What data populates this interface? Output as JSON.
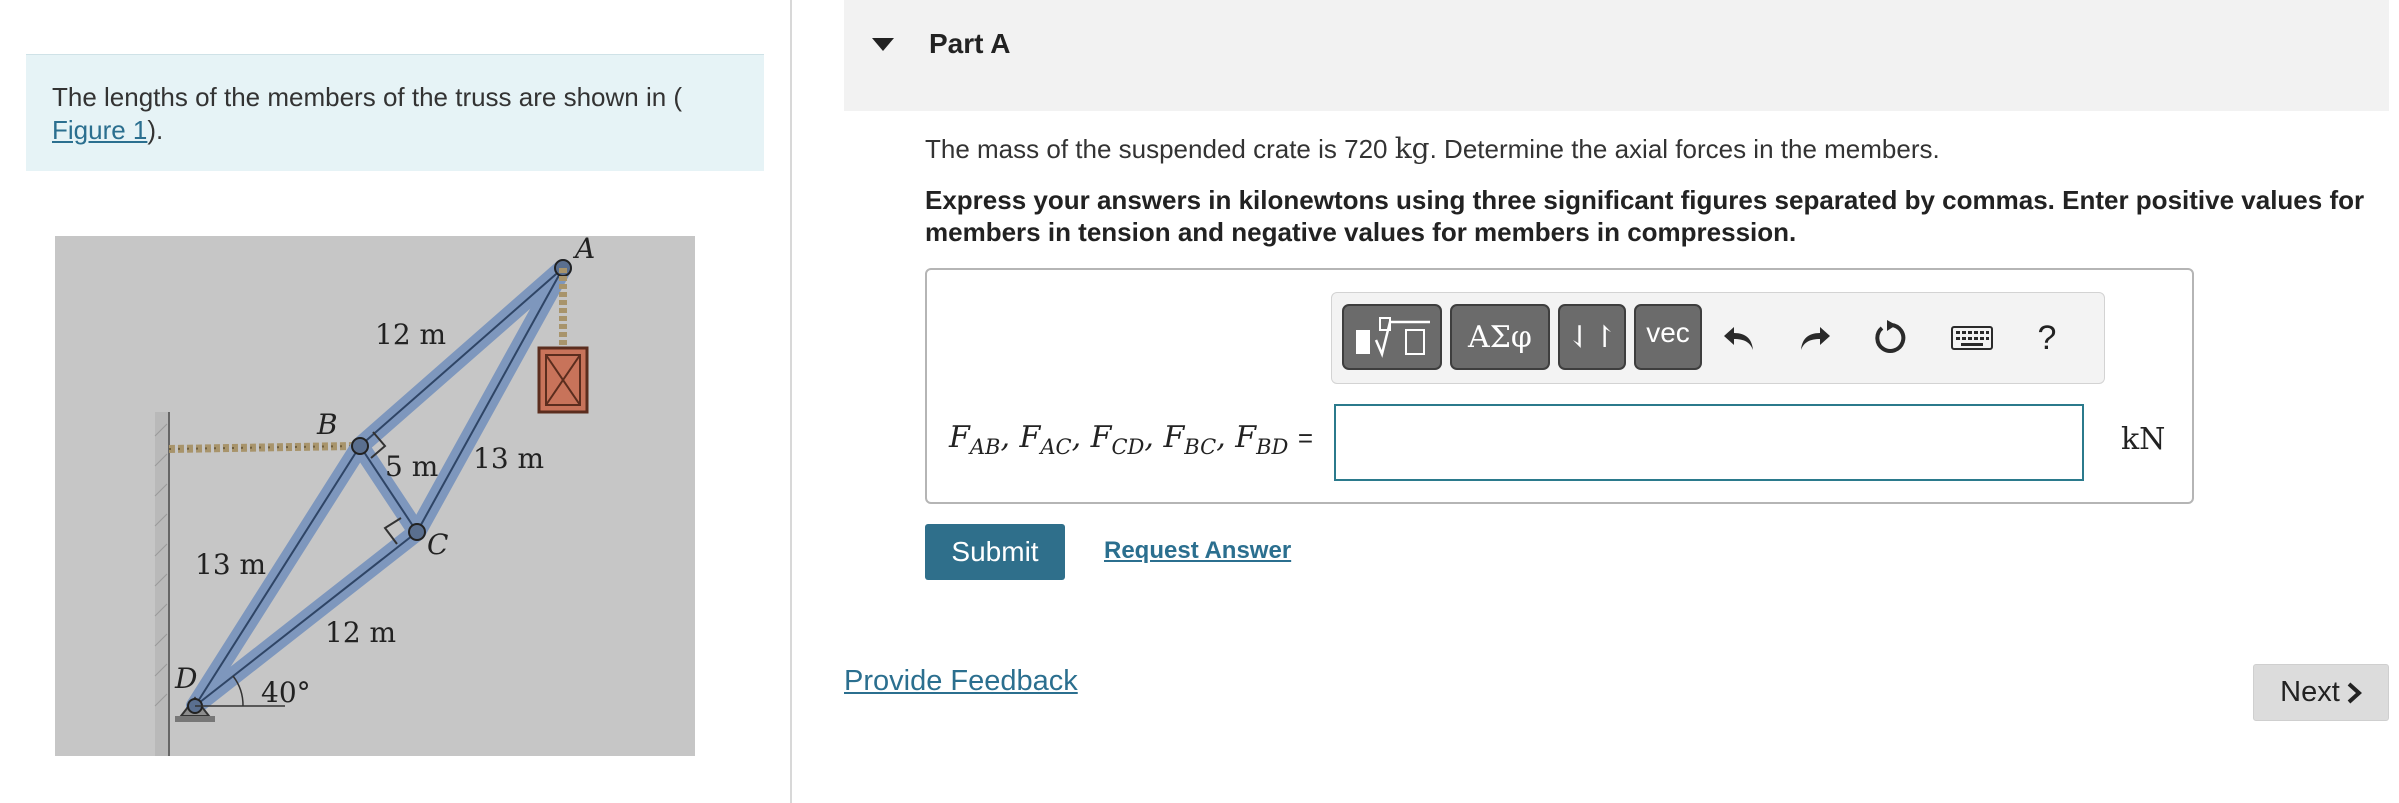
{
  "intro": {
    "text": "The lengths of the members of the truss are shown in (",
    "figure_link": "Figure 1",
    "text_after": ")."
  },
  "figure": {
    "labels": {
      "A": "A",
      "B": "B",
      "C": "C",
      "D": "D",
      "len_ab": "12 m",
      "len_bc": "5 m",
      "len_ac": "13 m",
      "len_bd": "13 m",
      "len_cd": "12 m",
      "angle": "40°"
    }
  },
  "part": {
    "title": "Part A"
  },
  "problem": {
    "text_before": "The mass of the suspended crate is 720 ",
    "unit": "kg",
    "text_after": ". Determine the axial forces in the members."
  },
  "instructions": "Express your answers in kilonewtons using three significant figures separated by commas. Enter positive values for members in tension and negative values for members in compression.",
  "toolbar": {
    "templates": "templates-icon",
    "symbols_label": "ΑΣφ",
    "arrows_label": "⇃↾",
    "vec_label": "vec",
    "help_label": "?"
  },
  "answer": {
    "forces": [
      "F",
      "AB",
      "F",
      "AC",
      "F",
      "CD",
      "F",
      "BC",
      "F",
      "BD"
    ],
    "equals": "=",
    "value": "",
    "unit": "kN"
  },
  "actions": {
    "submit": "Submit",
    "request_answer": "Request Answer",
    "provide_feedback": "Provide Feedback",
    "next": "Next"
  }
}
